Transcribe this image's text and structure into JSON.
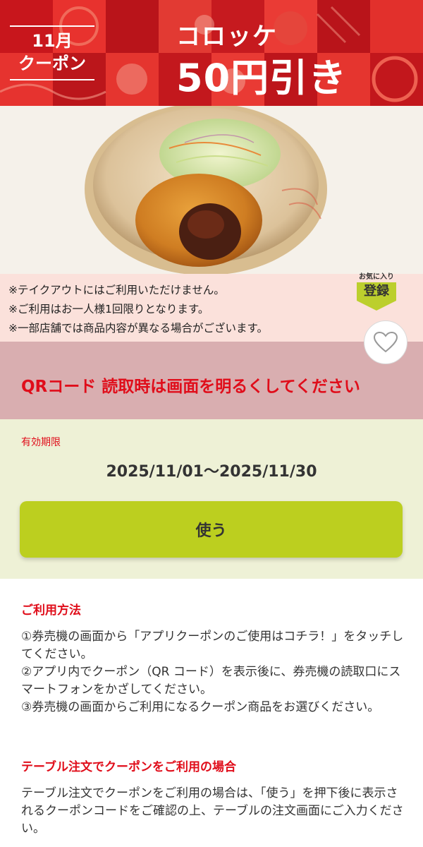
{
  "banner": {
    "month_line1": "11月",
    "month_line2": "クーポン",
    "product_name": "コロッケ",
    "discount": "50円引き",
    "colors": {
      "primary": "#d81e1e",
      "dark": "#b3141a",
      "light": "#ee3a35"
    }
  },
  "notes": [
    "※テイクアウトにはご利用いただけません。",
    "※ご利用はお一人様1回限りとなります。",
    "※一部店舗では商品内容が異なる場合がございます。"
  ],
  "favorite": {
    "top_label": "お気に入り",
    "main_label": "登録",
    "icon": "heart-icon"
  },
  "qr_notice": "QRコード 読取時は画面を明るくしてください",
  "validity": {
    "label": "有効期限",
    "dates": "2025/11/01〜2025/11/30"
  },
  "use_button_label": "使う",
  "instructions": {
    "title": "ご利用方法",
    "steps": [
      "①券売機の画面から「アプリクーポンのご使用はコチラ！」をタッチしてください。",
      "②アプリ内でクーポン（QR コード）を表示後に、券売機の読取口にスマートフォンをかざしてください。",
      "③券売機の画面からご利用になるクーポン商品をお選びください。"
    ]
  },
  "table_order": {
    "title": "テーブル注文でクーポンをご利用の場合",
    "text": "テーブル注文でクーポンをご利用の場合は、「使う」を押下後に表示されるクーポンコードをご確認の上、テーブルの注文画面にご入力ください。"
  },
  "accent_colors": {
    "red": "#e00d1a",
    "lime": "#bccf1f",
    "pink_bg": "#fbe1db",
    "qr_bg": "#d9aeb0",
    "validity_bg": "#eef1d6"
  }
}
